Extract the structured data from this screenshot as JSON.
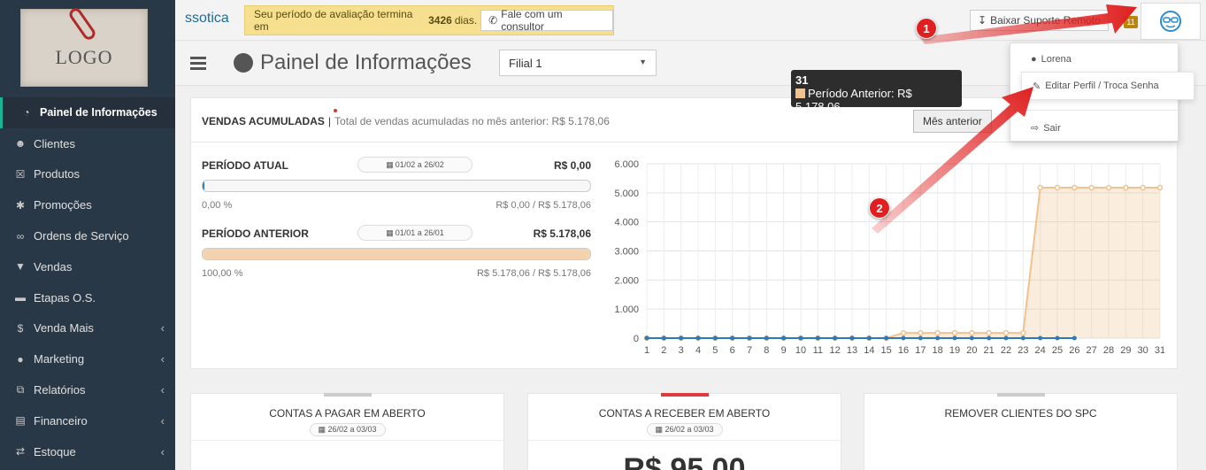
{
  "sidebar": {
    "logo": "LOGO",
    "items": [
      {
        "label": "Painel de Informações",
        "icon": "dashboard-icon",
        "active": true
      },
      {
        "label": "Clientes",
        "icon": "users-icon"
      },
      {
        "label": "Produtos",
        "icon": "cart-icon"
      },
      {
        "label": "Promoções",
        "icon": "asterisk-icon"
      },
      {
        "label": "Ordens de Serviço",
        "icon": "glasses-icon"
      },
      {
        "label": "Vendas",
        "icon": "basket-icon"
      },
      {
        "label": "Etapas O.S.",
        "icon": "card-icon"
      },
      {
        "label": "Venda Mais",
        "icon": "dollar-icon",
        "chevron": true
      },
      {
        "label": "Marketing",
        "icon": "chat-icon",
        "chevron": true
      },
      {
        "label": "Relatórios",
        "icon": "copy-icon",
        "chevron": true
      },
      {
        "label": "Financeiro",
        "icon": "money-icon",
        "chevron": true
      },
      {
        "label": "Estoque",
        "icon": "exchange-icon",
        "chevron": true
      }
    ]
  },
  "topbar": {
    "brand": "ssotica",
    "trial_prefix": "Seu período de avaliação termina em",
    "trial_days": "3426",
    "trial_suffix": "dias.",
    "consult_label": "Fale com um consultor",
    "download_label": "Baixar Suporte Remoto",
    "notif_count": "11"
  },
  "header": {
    "title": "Painel de Informações",
    "filial": "Filial 1"
  },
  "user_menu": {
    "user": "Lorena",
    "edit_profile": "Editar Perfil / Troca Senha",
    "logout": "Sair"
  },
  "panel": {
    "title": "VENDAS ACUMULADAS",
    "separator": "|",
    "subtitle": "Total de vendas acumuladas no mês anterior: R$ 5.178,06",
    "mes_anterior": "Mês anterior",
    "periods": [
      {
        "label": "PERÍODO ATUAL",
        "date": "01/02 a 26/02",
        "value": "R$ 0,00",
        "pct": "0,00 %",
        "range": "R$ 0,00 / R$ 5.178,06",
        "fill": 0.0
      },
      {
        "label": "PERÍODO ANTERIOR",
        "date": "01/01 a 26/01",
        "value": "R$ 5.178,06",
        "pct": "100,00 %",
        "range": "R$ 5.178,06 / R$ 5.178,06",
        "fill": 1.0
      }
    ]
  },
  "tooltip": {
    "title": "31",
    "text": "Período Anterior: R$ 5.178,06"
  },
  "chart_data": {
    "type": "line",
    "x": [
      1,
      2,
      3,
      4,
      5,
      6,
      7,
      8,
      9,
      10,
      11,
      12,
      13,
      14,
      15,
      16,
      17,
      18,
      19,
      20,
      21,
      22,
      23,
      24,
      25,
      26,
      27,
      28,
      29,
      30,
      31
    ],
    "yticks": [
      "0",
      "1.000",
      "2.000",
      "3.000",
      "4.000",
      "5.000",
      "6.000"
    ],
    "ylim": [
      0,
      6000
    ],
    "grid": true,
    "series": [
      {
        "name": "Período Anterior",
        "color": "#f0c28f",
        "values": [
          0,
          0,
          0,
          0,
          0,
          0,
          0,
          0,
          0,
          0,
          0,
          0,
          0,
          0,
          0,
          178.06,
          178.06,
          178.06,
          178.06,
          178.06,
          178.06,
          178.06,
          178.06,
          5178.06,
          5178.06,
          5178.06,
          5178.06,
          5178.06,
          5178.06,
          5178.06,
          5178.06
        ]
      },
      {
        "name": "Período Atual",
        "color": "#2e7ab8",
        "values": [
          0,
          0,
          0,
          0,
          0,
          0,
          0,
          0,
          0,
          0,
          0,
          0,
          0,
          0,
          0,
          0,
          0,
          0,
          0,
          0,
          0,
          0,
          0,
          0,
          0,
          0
        ]
      }
    ]
  },
  "cards": [
    {
      "title": "CONTAS A PAGAR EM ABERTO",
      "date": "26/02 a 03/03",
      "value": "",
      "accent": "#cccccc"
    },
    {
      "title": "CONTAS A RECEBER EM ABERTO",
      "date": "26/02 a 03/03",
      "value": "R$ 95,00",
      "accent": "#e0393e"
    },
    {
      "title": "REMOVER CLIENTES DO SPC",
      "date": "",
      "value": "",
      "accent": "#cccccc"
    }
  ],
  "annotations": [
    "1",
    "2"
  ]
}
